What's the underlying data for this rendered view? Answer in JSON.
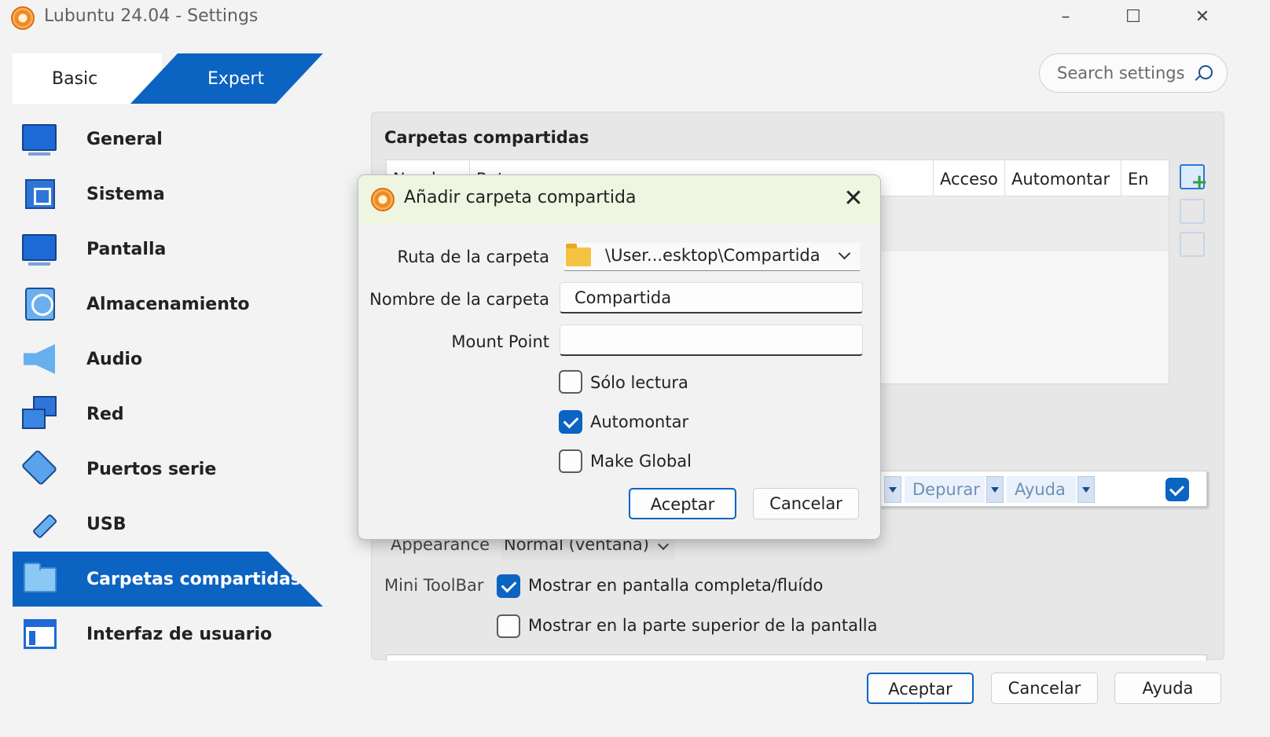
{
  "window": {
    "title": "Lubuntu 24.04 - Settings",
    "controls": {
      "minimize": "–",
      "maximize": "☐",
      "close": "✕"
    }
  },
  "mode_tabs": {
    "basic": "Basic",
    "expert": "Expert",
    "active": "Expert"
  },
  "search": {
    "placeholder": "Search settings",
    "icon": "search-icon"
  },
  "sidebar": {
    "items": [
      {
        "label": "General",
        "icon": "monitor-icon"
      },
      {
        "label": "Sistema",
        "icon": "chip-icon"
      },
      {
        "label": "Pantalla",
        "icon": "display-icon"
      },
      {
        "label": "Almacenamiento",
        "icon": "storage-icon"
      },
      {
        "label": "Audio",
        "icon": "speaker-icon"
      },
      {
        "label": "Red",
        "icon": "network-icon"
      },
      {
        "label": "Puertos serie",
        "icon": "serial-port-icon"
      },
      {
        "label": "USB",
        "icon": "usb-icon"
      },
      {
        "label": "Carpetas compartidas",
        "icon": "shared-folder-icon"
      },
      {
        "label": "Interfaz de usuario",
        "icon": "window-icon"
      }
    ],
    "active": "Carpetas compartidas"
  },
  "shared_folders": {
    "title": "Carpetas compartidas",
    "columns": [
      "Nombre",
      "Ruta",
      "Acceso",
      "Automontar",
      "En"
    ],
    "visible_header_fragments": [
      "Acceso",
      "Automontar",
      "En"
    ]
  },
  "status_strip": {
    "items": [
      "Depurar",
      "Ayuda"
    ],
    "checked": true
  },
  "ui_settings": {
    "appearance_label": "Appearance",
    "appearance_value": "Normal (ventana)",
    "minitoolbar_label": "Mini ToolBar",
    "minitoolbar_fullscreen": {
      "label": "Mostrar en pantalla completa/fluído",
      "checked": true
    },
    "minitoolbar_top": {
      "label": "Mostrar en la parte superior de la pantalla",
      "checked": false
    }
  },
  "footer_buttons": {
    "ok": "Aceptar",
    "cancel": "Cancelar",
    "help": "Ayuda"
  },
  "dialog": {
    "title": "Añadir carpeta compartida",
    "close": "✕",
    "path_label": "Ruta de la carpeta",
    "path_value": "\\User...esktop\\Compartida",
    "name_label": "Nombre de la carpeta",
    "name_value": "Compartida",
    "mount_label": "Mount Point",
    "mount_value": "",
    "readonly": {
      "label": "Sólo lectura",
      "checked": false
    },
    "automount": {
      "label": "Automontar",
      "checked": true
    },
    "global": {
      "label": "Make Global",
      "checked": false
    },
    "ok": "Aceptar",
    "cancel": "Cancelar"
  },
  "colors": {
    "accent": "#0b63c2",
    "dialog_title_bg": "#eef6e2",
    "window_bg": "#f3f3f3"
  }
}
